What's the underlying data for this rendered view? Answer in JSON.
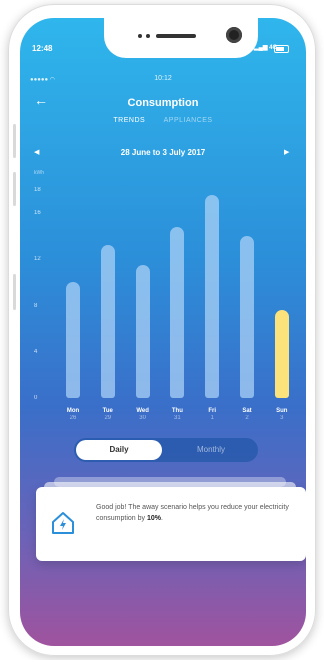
{
  "status_bar": {
    "time": "12:48",
    "network": "4G"
  },
  "inner_status": {
    "signal": "●●●●● ",
    "time": "10:12"
  },
  "header": {
    "back_icon": "back-arrow-icon",
    "title": "Consumption"
  },
  "tabs": [
    {
      "label": "TRENDS",
      "active": true
    },
    {
      "label": "APPLIANCES",
      "active": false
    }
  ],
  "date_nav": {
    "label": "28 June to 3 July 2017",
    "prev_icon": "chevron-left-icon",
    "next_icon": "chevron-right-icon"
  },
  "colors": {
    "bar": "#a9d0f5",
    "highlight_bar": "#fce27a",
    "accent": "#2c8fd9"
  },
  "chart_data": {
    "type": "bar",
    "unit_label": "kWh",
    "y_ticks": [
      "0",
      "4",
      "8",
      "12",
      "16",
      "18"
    ],
    "ylim": [
      0,
      18
    ],
    "categories": [
      {
        "day": "Mon",
        "date": "26"
      },
      {
        "day": "Tue",
        "date": "29"
      },
      {
        "day": "Wed",
        "date": "30"
      },
      {
        "day": "Thu",
        "date": "31"
      },
      {
        "day": "Fri",
        "date": "1"
      },
      {
        "day": "Sat",
        "date": "2"
      },
      {
        "day": "Sun",
        "date": "3"
      }
    ],
    "values": [
      10,
      13.2,
      11.5,
      14.8,
      17.6,
      14,
      7.6
    ],
    "highlighted_index": 6
  },
  "period_toggle": {
    "options": [
      "Daily",
      "Monthly"
    ],
    "selected": "Daily"
  },
  "tip_card": {
    "icon": "home-energy-icon",
    "text_prefix": "Good job! The away scenario helps you reduce your electricity consumption by ",
    "highlight": "10%",
    "text_suffix": "."
  }
}
